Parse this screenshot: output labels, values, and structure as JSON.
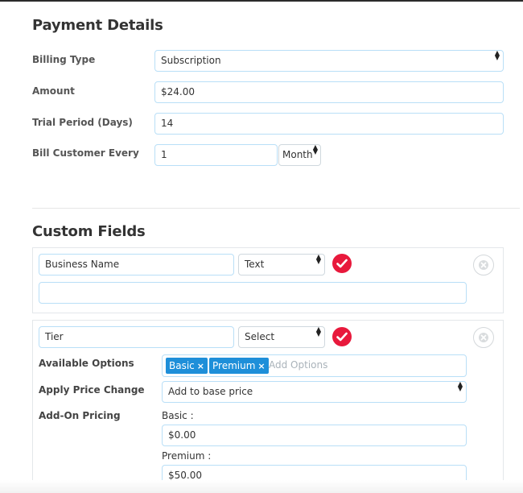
{
  "payment_details": {
    "title": "Payment Details",
    "billing_type": {
      "label": "Billing Type",
      "value": "Subscription"
    },
    "amount": {
      "label": "Amount",
      "value": "$24.00"
    },
    "trial_period": {
      "label": "Trial Period (Days)",
      "value": "14"
    },
    "bill_every": {
      "label": "Bill Customer Every",
      "value": "1",
      "unit": "Month"
    }
  },
  "custom_fields": {
    "title": "Custom Fields",
    "field1": {
      "name": "Business Name",
      "type": "Text",
      "default_value": ""
    },
    "field2": {
      "name": "Tier",
      "type": "Select",
      "available_options_label": "Available Options",
      "options": [
        "Basic",
        "Premium"
      ],
      "options_remove_glyph": "×",
      "add_options_placeholder": "Add Options",
      "apply_price_change_label": "Apply Price Change",
      "apply_price_change_value": "Add to base price",
      "addon_pricing_label": "Add-On Pricing",
      "basic_label": "Basic :",
      "basic_price": "$0.00",
      "premium_label": "Premium :",
      "premium_price": "$50.00"
    }
  },
  "colors": {
    "accent_blue": "#1e8fd9",
    "check_red": "#e8193c",
    "input_border": "#b9dff7"
  },
  "icons": {
    "confirm": "check-icon",
    "remove": "close-icon",
    "select_caret": "updown-caret-icon"
  }
}
